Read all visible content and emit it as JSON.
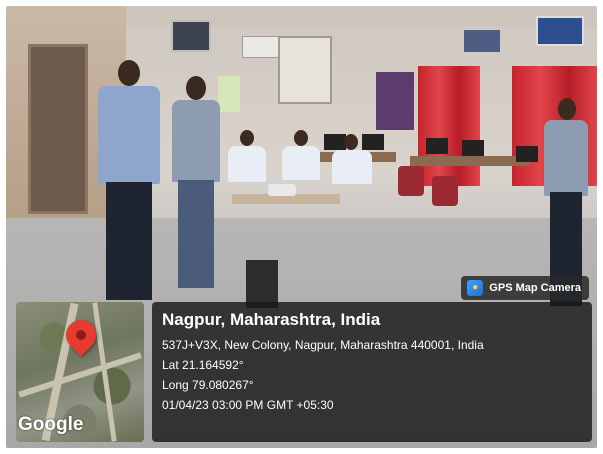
{
  "overlay": {
    "badge_label": "GPS Map Camera",
    "map": {
      "brand_text": "Google"
    },
    "location_title": "Nagpur, Maharashtra, India",
    "address": "537J+V3X, New Colony, Nagpur, Maharashtra 440001, India",
    "latitude": "Lat 21.164592°",
    "longitude": "Long 79.080267°",
    "timestamp": "01/04/23 03:00 PM GMT +05:30"
  },
  "colors": {
    "pin": "#e63b2e",
    "panel_background": "rgba(25,25,25,0.82)",
    "text": "#ffffff"
  }
}
